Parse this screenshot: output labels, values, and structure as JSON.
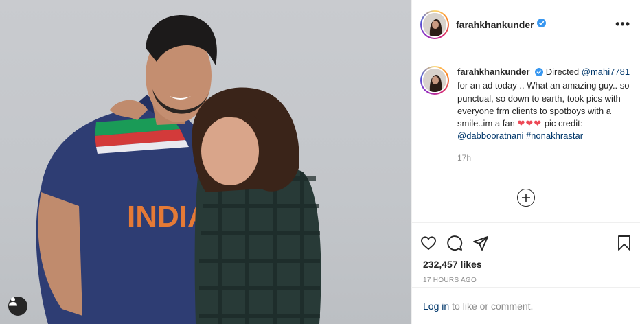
{
  "post": {
    "username": "farahkhankunder",
    "verified": true,
    "more_icon": "more-options-icon"
  },
  "caption": {
    "username": "farahkhankunder",
    "text_start": "Directed",
    "mention": "@mahi7781",
    "text_body": "for an ad today .. What an amazing guy.. so punctual, so down to earth, took pics with everyone frm clients to spotboys with a smile..im a fan",
    "hearts": "❤❤❤",
    "text_after_hearts": "pic credit:",
    "credit_mention": "@dabbooratnani",
    "hashtag": "#nonakhrastar",
    "time": "17h"
  },
  "photo": {
    "jersey_text": "INDIA"
  },
  "actions": {
    "icons": [
      "heart-icon",
      "comment-icon",
      "share-icon",
      "bookmark-icon"
    ]
  },
  "likes": "232,457 likes",
  "timestamp": "17 HOURS AGO",
  "login": {
    "link": "Log in",
    "text": "to like or comment."
  },
  "colors": {
    "link": "#00376b",
    "verified": "#3897f0",
    "heart": "#ed4956",
    "muted": "#8e8e8e"
  }
}
